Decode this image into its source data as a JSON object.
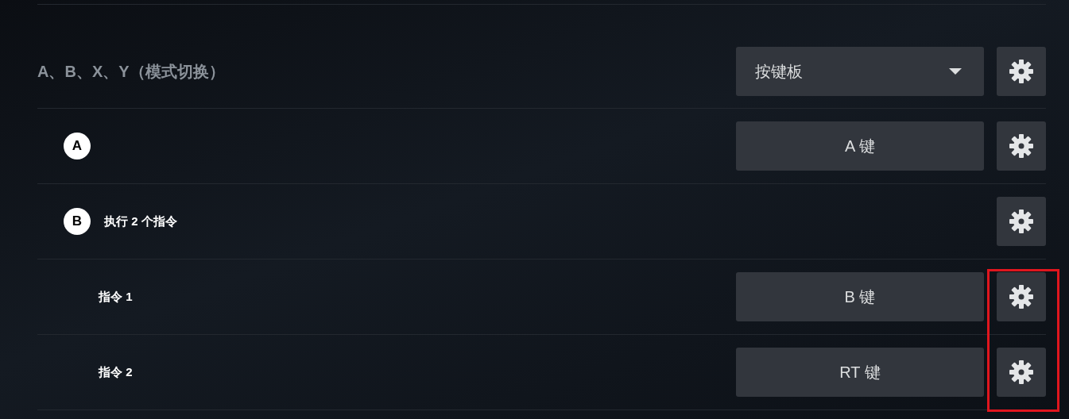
{
  "section": {
    "title": "A、B、X、Y（模式切换）",
    "mode_dropdown": {
      "value": "按键板"
    },
    "rows": [
      {
        "badge": "A",
        "binding": "A 键"
      },
      {
        "badge": "B",
        "label": "执行 2 个指令",
        "children_highlighted": true,
        "children": [
          {
            "label": "指令 1",
            "binding": "B 键"
          },
          {
            "label": "指令 2",
            "binding": "RT 键"
          }
        ]
      }
    ]
  }
}
